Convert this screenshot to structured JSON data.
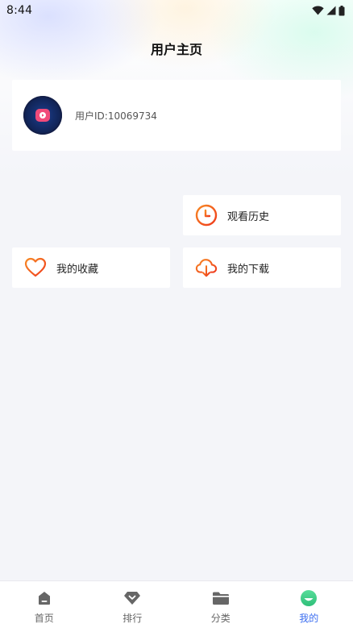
{
  "status_bar": {
    "time": "8:44"
  },
  "header": {
    "title": "用户主页"
  },
  "profile": {
    "user_id_text": "用户ID:10069734"
  },
  "menu": {
    "history_label": "观看历史",
    "favorites_label": "我的收藏",
    "downloads_label": "我的下载"
  },
  "bottom_nav": {
    "items": [
      {
        "label": "首页",
        "icon": "home-icon",
        "active": false
      },
      {
        "label": "排行",
        "icon": "ranking-icon",
        "active": false
      },
      {
        "label": "分类",
        "icon": "folder-icon",
        "active": false
      },
      {
        "label": "我的",
        "icon": "profile-icon",
        "active": true
      }
    ]
  },
  "colors": {
    "accent_orange": "#f35b1e",
    "active_tab": "#3a6cf0",
    "profile_tab_icon": "#3cd08a"
  }
}
